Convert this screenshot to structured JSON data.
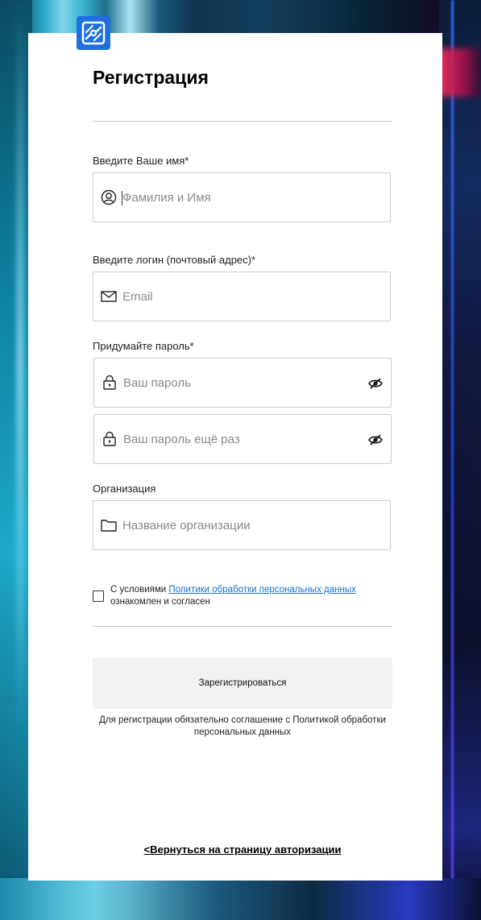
{
  "app": {
    "logo_icon": "brand-logo-icon",
    "accent_color": "#1f6fe0"
  },
  "form": {
    "title": "Регистрация",
    "name_label": "Введите Ваше имя*",
    "name_placeholder": "Фамилия и Имя",
    "name_icon": "user-circle-icon",
    "login_label": "Введите логин (почтовый адрес)*",
    "login_placeholder": "Email",
    "login_icon": "envelope-icon",
    "password_label": "Придумайте пароль*",
    "password_placeholder": "Ваш пароль",
    "password_repeat_placeholder": "Ваш пароль ещё раз",
    "password_icon": "lock-icon",
    "password_toggle_icon": "eye-icon",
    "org_label": "Организация",
    "org_placeholder": "Название организации",
    "org_icon": "folder-icon",
    "consent_prefix": "С условиями ",
    "consent_link": "Политики обработки персональных данных",
    "consent_suffix": " ознакомлен и согласен",
    "consent_checked": false,
    "submit_label": "Зарегистрироваться",
    "submit_note": "Для регистрации обязательно соглашение с Политикой обработки персональных данных",
    "back_link": "<Вернуться на страницу авторизации"
  }
}
